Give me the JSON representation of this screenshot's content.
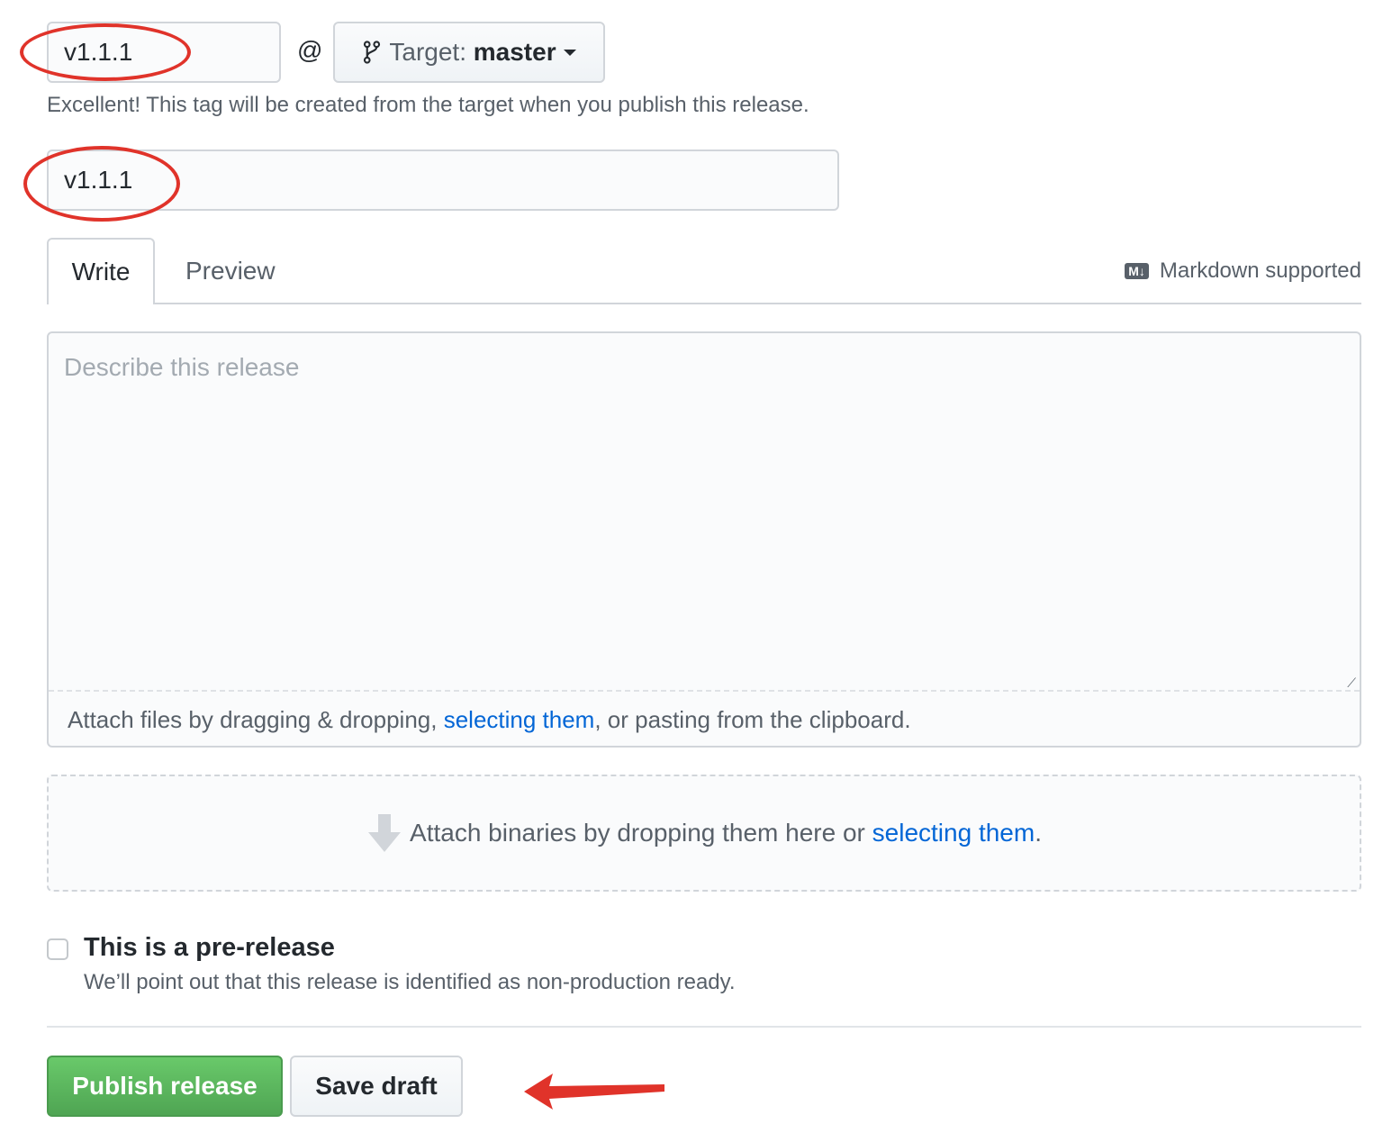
{
  "tag": {
    "value": "v1.1.1",
    "at_symbol": "@",
    "target_label": "Target:",
    "target_branch": "master",
    "hint": "Excellent! This tag will be created from the target when you publish this release."
  },
  "title": {
    "value": "v1.1.1"
  },
  "tabs": [
    {
      "label": "Write"
    },
    {
      "label": "Preview"
    }
  ],
  "markdown": {
    "label": "Markdown supported"
  },
  "description": {
    "placeholder": "Describe this release"
  },
  "attach_files": {
    "prefix": "Attach files by dragging & dropping, ",
    "link": "selecting them",
    "suffix": ", or pasting from the clipboard."
  },
  "attach_binaries": {
    "prefix": "Attach binaries by dropping them here or ",
    "link": "selecting them",
    "suffix": "."
  },
  "prerelease": {
    "label": "This is a pre-release",
    "description": "We’ll point out that this release is identified as non-production ready.",
    "checked": false
  },
  "actions": {
    "publish": "Publish release",
    "save_draft": "Save draft"
  },
  "colors": {
    "annotation": "#e0332a",
    "primary": "#28a745",
    "link": "#0366d6"
  }
}
